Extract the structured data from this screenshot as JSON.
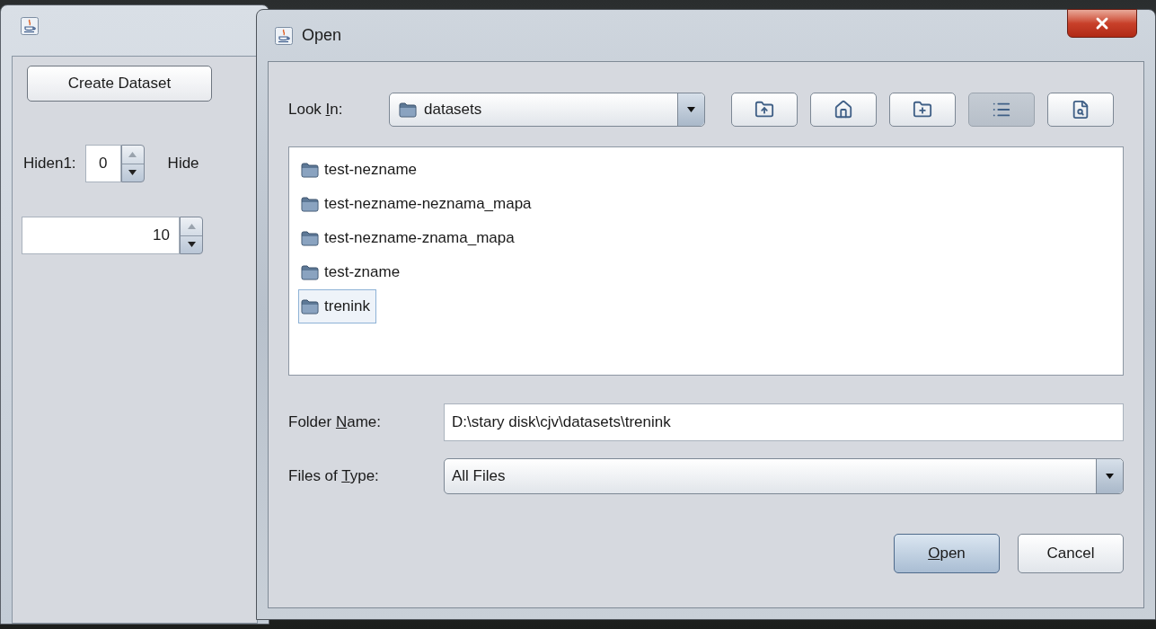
{
  "main_window": {
    "create_button": "Create Dataset",
    "spinners": [
      {
        "label": "Hiden1:",
        "value": "0"
      },
      {
        "label": "Hide"
      }
    ],
    "wide_spinner": {
      "value": "10"
    }
  },
  "dialog": {
    "title": "Open",
    "look_in": {
      "label": {
        "before": "Look ",
        "key": "I",
        "after": "n:"
      },
      "value": "datasets"
    },
    "toolbar": [
      {
        "kind": "up",
        "selected": false
      },
      {
        "kind": "home",
        "selected": false
      },
      {
        "kind": "new-folder",
        "selected": false
      },
      {
        "kind": "list",
        "selected": true
      },
      {
        "kind": "details",
        "selected": false
      }
    ],
    "files": [
      {
        "name": "test-nezname",
        "selected": false
      },
      {
        "name": "test-nezname-neznama_mapa",
        "selected": false
      },
      {
        "name": "test-nezname-znama_mapa",
        "selected": false
      },
      {
        "name": "test-zname",
        "selected": false
      },
      {
        "name": "trenink",
        "selected": true
      }
    ],
    "folder_name": {
      "label": {
        "before": "Folder ",
        "key": "N",
        "after": "ame:"
      },
      "value": "D:\\stary disk\\cjv\\datasets\\trenink"
    },
    "files_of_type": {
      "label": {
        "before": "Files of ",
        "key": "T",
        "after": "ype:"
      },
      "value": "All Files"
    },
    "buttons": [
      {
        "label": {
          "key": "O",
          "after": "pen"
        },
        "default": true
      },
      {
        "label": {
          "before": "Cancel"
        },
        "default": false
      }
    ]
  }
}
